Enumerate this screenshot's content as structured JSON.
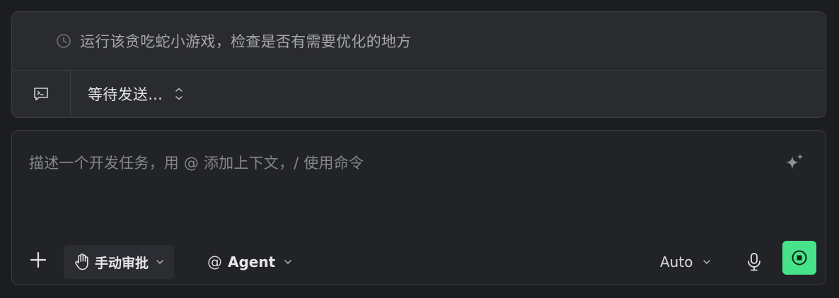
{
  "queue": {
    "message": "运行该贪吃蛇小游戏，检查是否有需要优化的地方",
    "pending_label": "等待发送..."
  },
  "composer": {
    "placeholder": "描述一个开发任务，用 @ 添加上下文，/ 使用命令",
    "value": ""
  },
  "toolbar": {
    "approval_mode": "手动审批",
    "at_symbol": "@",
    "agent_mode": "Agent",
    "model": "Auto"
  },
  "colors": {
    "accent": "#47e38a",
    "panel_bg": "#2a2b2f",
    "page_bg": "#1c1d20"
  },
  "icons": [
    "clock-icon",
    "terminal-icon",
    "chevron-up-down-icon",
    "sparkle-icon",
    "plus-icon",
    "hand-icon",
    "chevron-down-icon",
    "microphone-icon",
    "stop-icon"
  ]
}
